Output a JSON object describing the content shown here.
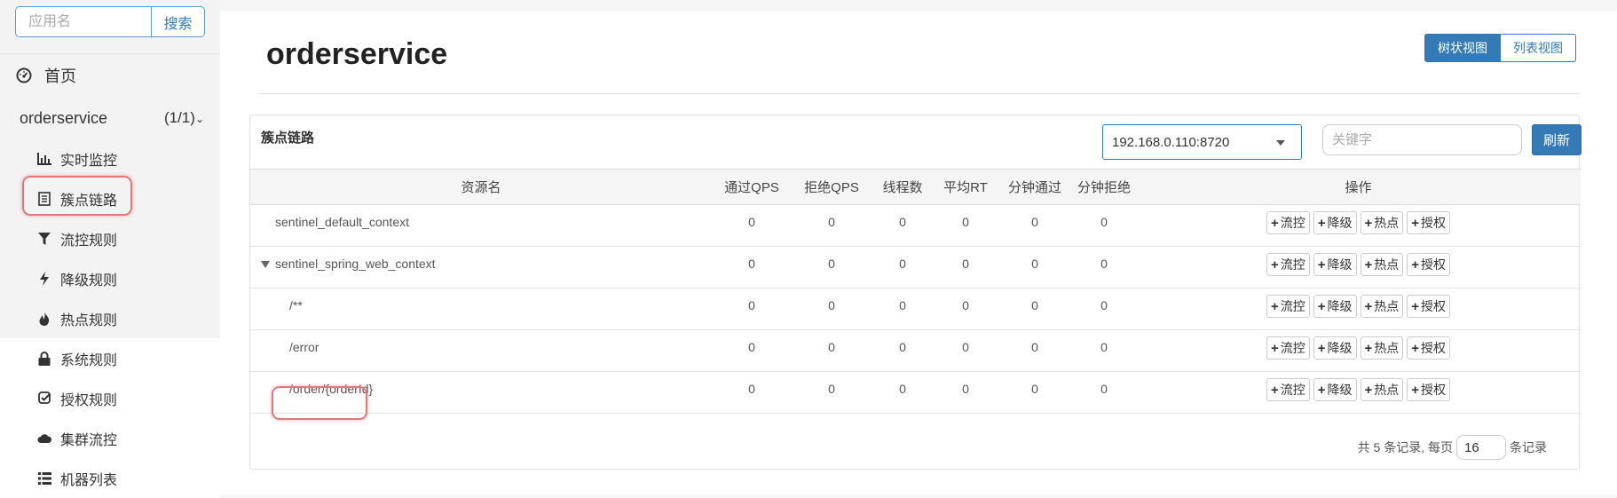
{
  "sidebar": {
    "search": {
      "placeholder": "应用名",
      "button": "搜索"
    },
    "home": "首页",
    "app": {
      "name": "orderservice",
      "count": "(1/1)"
    },
    "items": [
      {
        "label": "实时监控",
        "icon": "bar-chart-icon"
      },
      {
        "label": "簇点链路",
        "icon": "list-icon"
      },
      {
        "label": "流控规则",
        "icon": "filter-icon"
      },
      {
        "label": "降级规则",
        "icon": "bolt-icon"
      },
      {
        "label": "热点规则",
        "icon": "fire-icon"
      },
      {
        "label": "系统规则",
        "icon": "lock-icon"
      },
      {
        "label": "授权规则",
        "icon": "check-icon"
      },
      {
        "label": "集群流控",
        "icon": "cloud-icon"
      },
      {
        "label": "机器列表",
        "icon": "list-bullets-icon"
      }
    ]
  },
  "main": {
    "title": "orderservice",
    "view_toggle": {
      "tree": "树状视图",
      "list": "列表视图"
    },
    "panel": {
      "title": "簇点链路",
      "machine": "192.168.0.110:8720",
      "keyword_placeholder": "关键字",
      "refresh": "刷新"
    },
    "table": {
      "headers": [
        "资源名",
        "通过QPS",
        "拒绝QPS",
        "线程数",
        "平均RT",
        "分钟通过",
        "分钟拒绝",
        "操作"
      ],
      "rows": [
        {
          "resource": "sentinel_default_context",
          "values": [
            "0",
            "0",
            "0",
            "0",
            "0",
            "0"
          ]
        },
        {
          "resource": "sentinel_spring_web_context",
          "values": [
            "0",
            "0",
            "0",
            "0",
            "0",
            "0"
          ]
        },
        {
          "resource": "/**",
          "values": [
            "0",
            "0",
            "0",
            "0",
            "0",
            "0"
          ]
        },
        {
          "resource": "/error",
          "values": [
            "0",
            "0",
            "0",
            "0",
            "0",
            "0"
          ]
        },
        {
          "resource": "/order/{orderId}",
          "values": [
            "0",
            "0",
            "0",
            "0",
            "0",
            "0"
          ]
        }
      ],
      "ops": [
        "流控",
        "降级",
        "热点",
        "授权"
      ]
    },
    "pager": {
      "prefix": "共 5 条记录, 每页",
      "page_size": "16",
      "suffix": "条记录"
    }
  }
}
